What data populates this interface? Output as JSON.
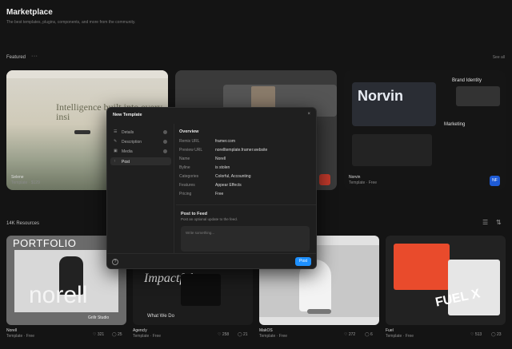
{
  "header": {
    "title": "Marketplace",
    "subtitle": "The best templates, plugins, components, and more from the community."
  },
  "featured": {
    "label": "Featured",
    "more": "···",
    "see_all": "See all",
    "cards": [
      {
        "name": "Selene",
        "meta": "Template · $129",
        "hero_text": "Intelligence built into every insi"
      },
      {
        "name": "",
        "meta": ""
      },
      {
        "name": "Norvin",
        "meta": "Template · Free",
        "hero_text": "Norvin",
        "brand": "Brand Identity",
        "marketing": "Marketing",
        "badge": "NF"
      }
    ]
  },
  "resources": {
    "label": "14K Resources",
    "cards": [
      {
        "name": "Norell",
        "meta": "Template · Free",
        "likes": "321",
        "comments": "25",
        "hero_top": "PORTFOLIO",
        "hero_big": "norell",
        "studio": "Grillr Studio"
      },
      {
        "name": "Agencly",
        "meta": "Template · Free",
        "likes": "258",
        "comments": "21",
        "hero": "Impactful",
        "sub": "What We Do"
      },
      {
        "name": "MakOS",
        "meta": "Template · Free",
        "likes": "272",
        "comments": "6"
      },
      {
        "name": "Fuel",
        "meta": "Template · Free",
        "likes": "513",
        "comments": "23",
        "hero": "FUEL X"
      }
    ]
  },
  "modal": {
    "title": "New Template",
    "close": "×",
    "nav": [
      {
        "label": "Details",
        "icon": "☰"
      },
      {
        "label": "Description",
        "icon": "✎"
      },
      {
        "label": "Media",
        "icon": "▣"
      },
      {
        "label": "Post",
        "icon": "↑"
      }
    ],
    "overview_title": "Overview",
    "fields": [
      {
        "k": "Remix URL",
        "v": "framer.com"
      },
      {
        "k": "Preview URL",
        "v": "norelltemplate.framer.website"
      },
      {
        "k": "Name",
        "v": "Norell"
      },
      {
        "k": "Byline",
        "v": "is stolen"
      },
      {
        "k": "Categories",
        "v": "Colorful, Accounting"
      },
      {
        "k": "Features",
        "v": "Appear Effects"
      },
      {
        "k": "Pricing",
        "v": "Free"
      }
    ],
    "post_to_feed": {
      "title": "Post to Feed",
      "subtitle": "Post an optional update to the feed.",
      "placeholder": "Write something..."
    },
    "help": "?",
    "post_button": "Post",
    "accent": "#1e90ff"
  }
}
